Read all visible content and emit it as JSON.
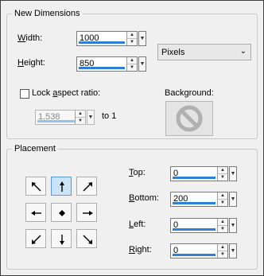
{
  "new_dimensions": {
    "title": "New Dimensions",
    "width_label": "Width:",
    "width_value": "1000",
    "height_label": "Height:",
    "height_value": "850",
    "units_value": "Pixels",
    "lock_label": "Lock aspect ratio:",
    "lock_checked": false,
    "ratio_value": "1,538",
    "to_label": "to 1",
    "background_label": "Background:",
    "background_icon": "no-color-icon"
  },
  "placement": {
    "title": "Placement",
    "selected": "top-center",
    "buttons": [
      "top-left",
      "top-center",
      "top-right",
      "middle-left",
      "center",
      "middle-right",
      "bottom-left",
      "bottom-center",
      "bottom-right"
    ],
    "top_label": "Top:",
    "top_value": "0",
    "bottom_label": "Bottom:",
    "bottom_value": "200",
    "left_label": "Left:",
    "left_value": "0",
    "right_label": "Right:",
    "right_value": "0"
  },
  "colors": {
    "accent": "#2d7fd6",
    "selected_button": "#cce4f7"
  }
}
